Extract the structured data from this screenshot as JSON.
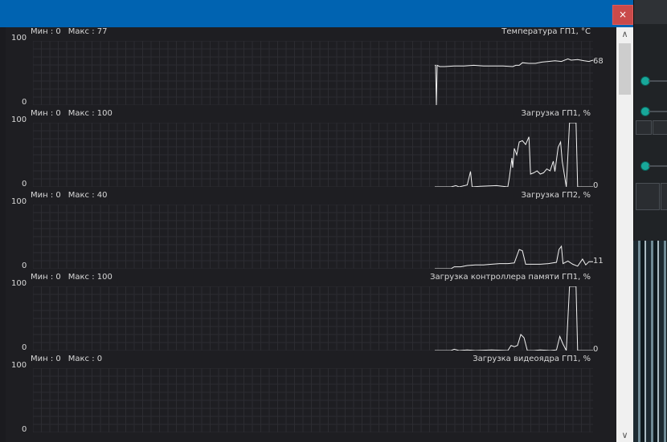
{
  "window": {
    "close_label": "×"
  },
  "scrollbar": {
    "up_label": "∧",
    "down_label": "∨"
  },
  "graphs": [
    {
      "min_label": "Мин : 0",
      "max_label": "Макс : 77",
      "title": "Температура ГП1, °C",
      "y_max": "100",
      "y_min": "0",
      "current": "68",
      "current_value": 68,
      "series": [
        [
          0,
          62
        ],
        [
          1,
          62
        ],
        [
          2,
          0
        ],
        [
          3,
          62
        ],
        [
          6,
          60
        ],
        [
          12,
          60
        ],
        [
          24,
          61
        ],
        [
          36,
          61
        ],
        [
          48,
          62
        ],
        [
          60,
          61
        ],
        [
          72,
          61
        ],
        [
          84,
          61
        ],
        [
          96,
          60
        ],
        [
          100,
          62
        ],
        [
          104,
          62
        ],
        [
          108,
          66
        ],
        [
          116,
          65
        ],
        [
          124,
          65
        ],
        [
          132,
          67
        ],
        [
          140,
          68
        ],
        [
          148,
          69
        ],
        [
          156,
          68
        ],
        [
          164,
          72
        ],
        [
          168,
          70
        ],
        [
          176,
          71
        ],
        [
          184,
          69
        ],
        [
          190,
          68
        ],
        [
          195,
          70
        ]
      ],
      "y_axis_max": 100
    },
    {
      "min_label": "Мин : 0",
      "max_label": "Макс : 100",
      "title": "Загрузка ГП1, %",
      "y_max": "100",
      "y_min": "0",
      "current": "0",
      "current_value": 0,
      "series": [
        [
          0,
          0
        ],
        [
          20,
          0
        ],
        [
          26,
          2
        ],
        [
          30,
          0
        ],
        [
          40,
          3
        ],
        [
          44,
          24
        ],
        [
          46,
          0
        ],
        [
          56,
          1
        ],
        [
          76,
          2
        ],
        [
          90,
          0
        ],
        [
          92,
          15
        ],
        [
          95,
          45
        ],
        [
          96,
          30
        ],
        [
          98,
          60
        ],
        [
          101,
          50
        ],
        [
          104,
          70
        ],
        [
          108,
          72
        ],
        [
          112,
          66
        ],
        [
          116,
          78
        ],
        [
          118,
          20
        ],
        [
          122,
          22
        ],
        [
          126,
          25
        ],
        [
          130,
          20
        ],
        [
          134,
          22
        ],
        [
          138,
          28
        ],
        [
          142,
          25
        ],
        [
          146,
          40
        ],
        [
          148,
          24
        ],
        [
          152,
          62
        ],
        [
          155,
          70
        ],
        [
          157,
          40
        ],
        [
          162,
          0
        ],
        [
          166,
          100
        ],
        [
          174,
          100
        ],
        [
          176,
          0
        ],
        [
          195,
          0
        ]
      ],
      "y_axis_max": 100
    },
    {
      "min_label": "Мин : 0",
      "max_label": "Макс : 40",
      "title": "Загрузка ГП2, %",
      "y_max": "100",
      "y_min": "0",
      "current": "11",
      "current_value": 11,
      "series": [
        [
          0,
          0
        ],
        [
          20,
          0
        ],
        [
          24,
          3
        ],
        [
          32,
          3
        ],
        [
          40,
          5
        ],
        [
          50,
          6
        ],
        [
          60,
          6
        ],
        [
          70,
          7
        ],
        [
          80,
          8
        ],
        [
          90,
          8
        ],
        [
          98,
          9
        ],
        [
          104,
          30
        ],
        [
          108,
          28
        ],
        [
          112,
          7
        ],
        [
          120,
          7
        ],
        [
          130,
          7
        ],
        [
          140,
          8
        ],
        [
          150,
          10
        ],
        [
          153,
          30
        ],
        [
          156,
          35
        ],
        [
          158,
          8
        ],
        [
          164,
          12
        ],
        [
          170,
          7
        ],
        [
          176,
          4
        ],
        [
          182,
          15
        ],
        [
          186,
          6
        ],
        [
          190,
          11
        ],
        [
          195,
          11
        ]
      ],
      "y_axis_max": 100
    },
    {
      "min_label": "Мин : 0",
      "max_label": "Макс : 100",
      "title": "Загрузка контроллера памяти ГП1, %",
      "y_max": "100",
      "y_min": "0",
      "current": "0",
      "current_value": 0,
      "series": [
        [
          0,
          0
        ],
        [
          20,
          0
        ],
        [
          24,
          2
        ],
        [
          30,
          0
        ],
        [
          40,
          1
        ],
        [
          50,
          0
        ],
        [
          70,
          1
        ],
        [
          90,
          0
        ],
        [
          94,
          8
        ],
        [
          98,
          6
        ],
        [
          102,
          8
        ],
        [
          106,
          25
        ],
        [
          110,
          20
        ],
        [
          114,
          0
        ],
        [
          122,
          0
        ],
        [
          130,
          1
        ],
        [
          142,
          0
        ],
        [
          150,
          1
        ],
        [
          154,
          22
        ],
        [
          158,
          10
        ],
        [
          162,
          0
        ],
        [
          166,
          100
        ],
        [
          174,
          100
        ],
        [
          176,
          0
        ],
        [
          195,
          0
        ]
      ],
      "y_axis_max": 100
    },
    {
      "min_label": "Мин : 0",
      "max_label": "Макс : 0",
      "title": "Загрузка видеоядра ГП1, %",
      "y_max": "100",
      "y_min": "0",
      "current": "",
      "current_value": null,
      "series": [],
      "y_axis_max": 100
    }
  ]
}
